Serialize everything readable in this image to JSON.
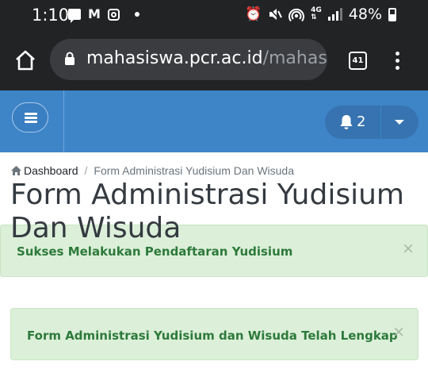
{
  "status_bar": {
    "time": "1:10",
    "network_type": "4G",
    "battery_percent": "48%",
    "notification_icons": [
      "message-icon",
      "gmail-icon",
      "instagram-icon",
      "dot-icon"
    ],
    "system_icons": [
      "alarm-icon",
      "mute-icon",
      "hotspot-icon",
      "network-icon",
      "signal-icon",
      "battery-icon"
    ]
  },
  "browser": {
    "url_host": "mahasiswa.pcr.ac.id",
    "url_path": "/mahasi",
    "tab_count": "41"
  },
  "navbar": {
    "notification_count": "2",
    "colors": {
      "navbar": "#3e85c8",
      "button": "#3773b0"
    }
  },
  "breadcrumb": {
    "home": "Dashboard",
    "separator": "/",
    "current": "Form Administrasi Yudisium Dan Wisuda"
  },
  "page": {
    "title": "Form Administrasi Yudisium Dan Wisuda"
  },
  "alerts": [
    {
      "message": "Sukses Melakukan Pendaftaran Yudisium",
      "close": "×"
    },
    {
      "message": "Form Administrasi Yudisium dan Wisuda Telah Lengkap",
      "close": "×"
    }
  ]
}
